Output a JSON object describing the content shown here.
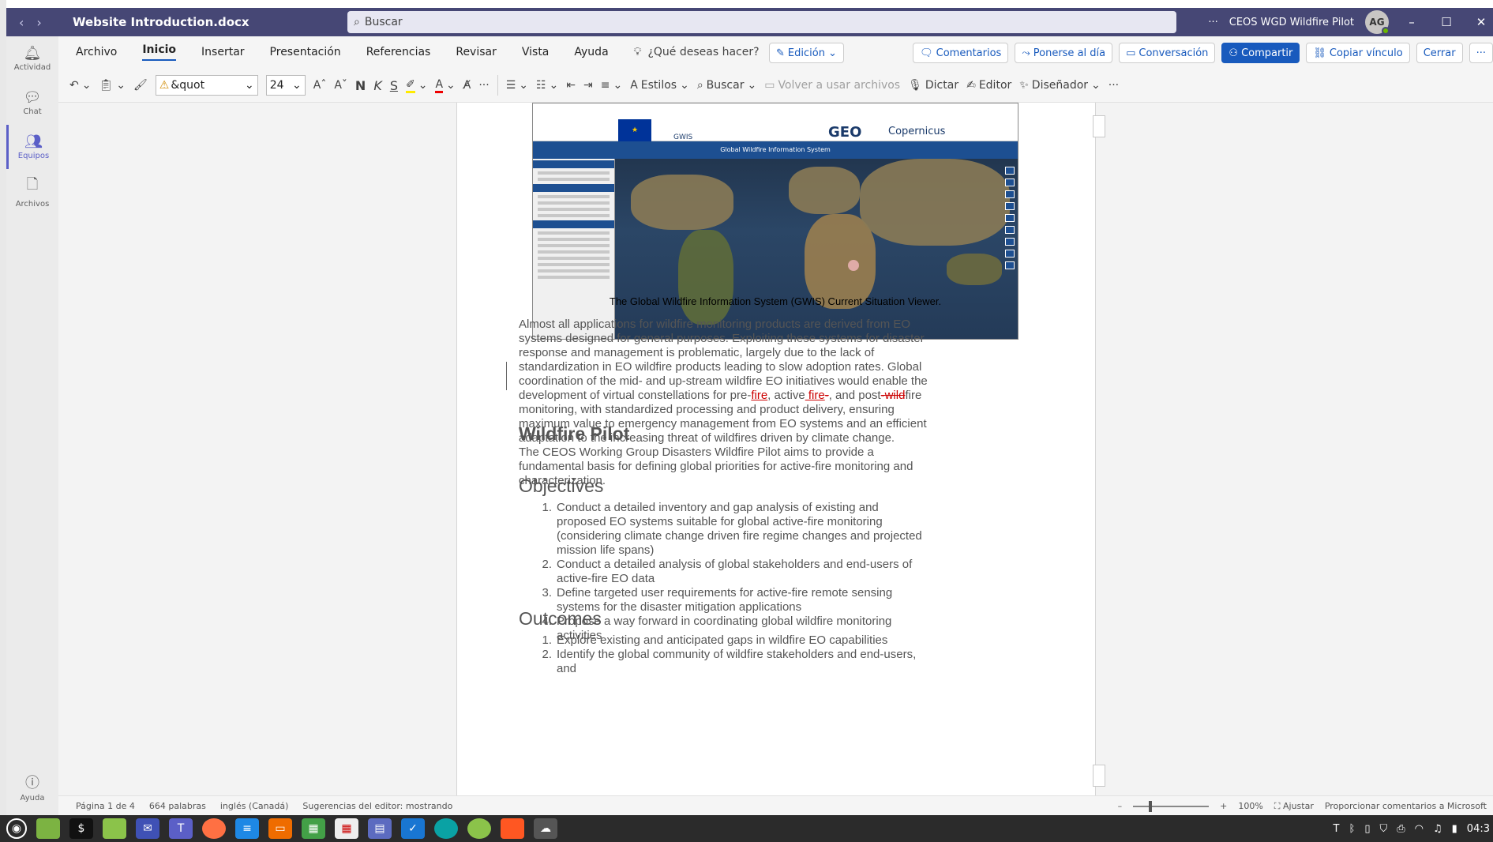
{
  "window": {
    "doc_title": "Website Introduction.docx",
    "search_placeholder": "Buscar",
    "more": "···",
    "team_name": "CEOS WGD Wildfire Pilot",
    "avatar_initials": "AG",
    "minimize": "–",
    "maximize": "☐",
    "close": "✕",
    "back": "‹",
    "forward": "›"
  },
  "rail": {
    "items": [
      {
        "label": "Actividad",
        "icon": "bell-icon"
      },
      {
        "label": "Chat",
        "icon": "chat-icon"
      },
      {
        "label": "Equipos",
        "icon": "teams-icon"
      },
      {
        "label": "Archivos",
        "icon": "file-icon"
      }
    ],
    "help": "Ayuda"
  },
  "ribbon": {
    "menu": [
      "Archivo",
      "Inicio",
      "Insertar",
      "Presentación",
      "Referencias",
      "Revisar",
      "Vista",
      "Ayuda"
    ],
    "tell_me": "¿Qué deseas hacer?",
    "mode": "Edición",
    "comments": "Comentarios",
    "catch_up": "Ponerse al día",
    "conversation": "Conversación",
    "share": "Compartir",
    "copy_link": "Copiar vínculo",
    "close": "Cerrar",
    "more": "···",
    "font_name": "&quot",
    "font_size": "24",
    "grow": "Aˆ",
    "shrink": "Aˇ",
    "bold": "N",
    "italic": "K",
    "underline": "S",
    "styles": "Estilos",
    "find": "Buscar",
    "reuse": "Volver a usar archivos",
    "dictate": "Dictar",
    "editor": "Editor",
    "designer": "Diseñador"
  },
  "document": {
    "map_gwis": "GWIS",
    "map_geo": "GEO",
    "map_copernicus": "Copernicus",
    "map_title": "Global Wildfire Information System",
    "caption": "The Global Wildfire Information System (GWIS) Current Situation Viewer.",
    "p1_a": "Almost all applications for wildfire monitoring products are derived from EO systems designed for general purposes. Exploiting these systems for disaster response and management is problematic, largely due to the lack of standardization in EO wildfire products leading to slow adoption rates. Global coordination of the mid- and up-stream wildfire EO initiatives would enable the development of virtual constellations for pre-",
    "p1_ins1": "fire",
    "p1_b": ", active",
    "p1_ins2": " fire",
    "p1_del1": "-",
    "p1_c": ", and post",
    "p1_del2": "-wild",
    "p1_d": "fire monitoring, with standardized processing and product delivery, ensuring maximum value to emergency management from EO systems and an efficient adaptation to the increasing threat of wildfires driven by climate change.",
    "h_pilot": "Wildfire Pilot",
    "p2": "The CEOS Working Group Disasters Wildfire Pilot aims to provide a fundamental basis for defining global priorities for active-fire monitoring and characterization.",
    "h_objectives": "Objectives",
    "objectives": [
      {
        "n": "1.",
        "text": "Conduct a detailed inventory and gap analysis of existing and proposed EO systems suitable for global active-fire monitoring (considering climate change driven fire regime changes and projected mission life spans)"
      },
      {
        "n": "2.",
        "text": "Conduct a detailed analysis of global stakeholders and end-users of active-fire EO data"
      },
      {
        "n": "3.",
        "text": "Define targeted user requirements for active-fire remote sensing systems for the disaster mitigation applications"
      },
      {
        "n": "4.",
        "text": "Propose a way forward in coordinating global wildfire monitoring activities"
      }
    ],
    "h_outcomes": "Outcomes",
    "outcomes": [
      {
        "n": "1.",
        "text": "Explore existing and anticipated gaps in wildfire EO capabilities"
      },
      {
        "n": "2.",
        "text": "Identify the global community of wildfire stakeholders and end-users, and"
      }
    ]
  },
  "status": {
    "page": "Página 1 de 4",
    "words": "664 palabras",
    "language": "inglés (Canadá)",
    "editor_suggestions": "Sugerencias del editor: mostrando",
    "zoom_out": "–",
    "zoom_in": "+",
    "zoom": "100%",
    "fit": "Ajustar",
    "feedback": "Proporcionar comentarios a Microsoft"
  },
  "taskbar": {
    "clock": "04:3"
  },
  "colors": {
    "titlebar": "#464775",
    "accent": "#185abd",
    "teams": "#5b5fc7",
    "track_change": "#cc0000"
  }
}
